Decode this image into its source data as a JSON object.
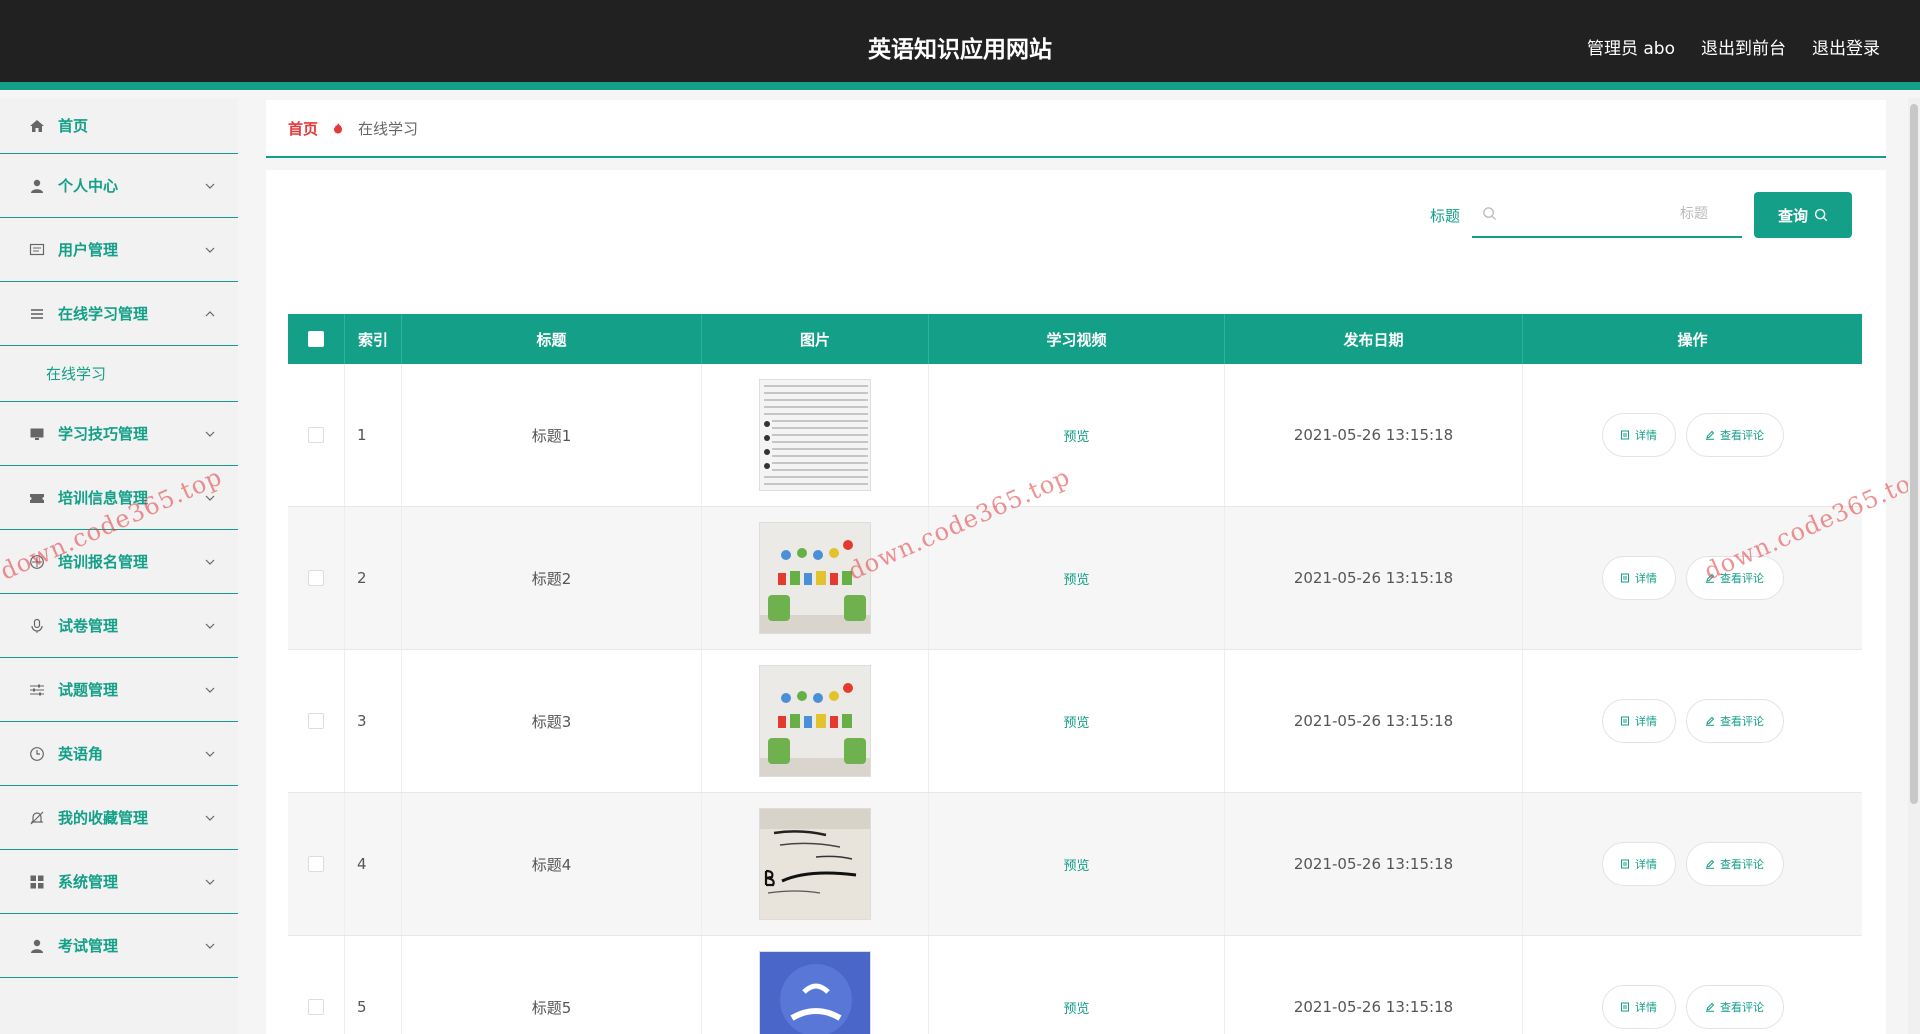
{
  "header": {
    "title": "英语知识应用网站",
    "admin": "管理员 abo",
    "to_front": "退出到前台",
    "logout": "退出登录"
  },
  "sidebar": {
    "items": [
      {
        "label": "首页",
        "icon": "home-icon"
      },
      {
        "label": "个人中心",
        "icon": "user-icon"
      },
      {
        "label": "用户管理",
        "icon": "message-icon"
      },
      {
        "label": "在线学习管理",
        "icon": "list-icon"
      },
      {
        "label": "学习技巧管理",
        "icon": "monitor-icon"
      },
      {
        "label": "培训信息管理",
        "icon": "ticket-icon"
      },
      {
        "label": "培训报名管理",
        "icon": "compass-icon"
      },
      {
        "label": "试卷管理",
        "icon": "microphone-icon"
      },
      {
        "label": "试题管理",
        "icon": "sliders-icon"
      },
      {
        "label": "英语角",
        "icon": "clock-icon"
      },
      {
        "label": "我的收藏管理",
        "icon": "bell-off-icon"
      },
      {
        "label": "系统管理",
        "icon": "grid-icon"
      },
      {
        "label": "考试管理",
        "icon": "user-icon"
      }
    ],
    "sub_item": "在线学习"
  },
  "breadcrumb": {
    "home": "首页",
    "current": "在线学习"
  },
  "search": {
    "label": "标题",
    "placeholder": "标题",
    "button": "查询"
  },
  "table": {
    "headers": [
      "索引",
      "标题",
      "图片",
      "学习视频",
      "发布日期",
      "操作"
    ],
    "rows": [
      {
        "index": "1",
        "title": "标题1",
        "video": "预览",
        "date": "2021-05-26 13:15:18",
        "detail": "详情",
        "comments": "查看评论"
      },
      {
        "index": "2",
        "title": "标题2",
        "video": "预览",
        "date": "2021-05-26 13:15:18",
        "detail": "详情",
        "comments": "查看评论"
      },
      {
        "index": "3",
        "title": "标题3",
        "video": "预览",
        "date": "2021-05-26 13:15:18",
        "detail": "详情",
        "comments": "查看评论"
      },
      {
        "index": "4",
        "title": "标题4",
        "video": "预览",
        "date": "2021-05-26 13:15:18",
        "detail": "详情",
        "comments": "查看评论"
      },
      {
        "index": "5",
        "title": "标题5",
        "video": "预览",
        "date": "2021-05-26 13:15:18",
        "detail": "详情",
        "comments": "查看评论"
      }
    ]
  },
  "watermark": "down.code365.top",
  "colors": {
    "accent": "#139f88",
    "header_bg": "#212121",
    "breadcrumb_home": "#e4393c"
  }
}
